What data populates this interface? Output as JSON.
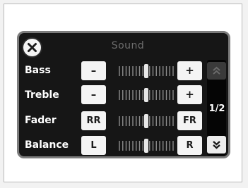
{
  "screen": {
    "title": "Sound",
    "page_indicator": "1/2"
  },
  "rows": [
    {
      "label": "Bass",
      "minus": "–",
      "plus": "+",
      "level": 0.5
    },
    {
      "label": "Treble",
      "minus": "–",
      "plus": "+",
      "level": 0.5
    },
    {
      "label": "Fader",
      "minus": "RR",
      "plus": "FR",
      "level": 0.5
    },
    {
      "label": "Balance",
      "minus": "L",
      "plus": "R",
      "level": 0.5
    }
  ],
  "icons": {
    "close": "close-icon",
    "page_up": "chevron-double-up-icon",
    "page_down": "chevron-double-down-icon"
  },
  "colors": {
    "screen_bg": "#161616",
    "button_bg": "#f4f4f4",
    "title": "#6e6e6e"
  }
}
